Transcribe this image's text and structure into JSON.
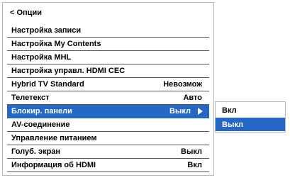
{
  "menu": {
    "title": "< Опции",
    "items": [
      {
        "label": "Настройка записи",
        "value": ""
      },
      {
        "label": "Настройка My Contents",
        "value": ""
      },
      {
        "label": "Настройка MHL",
        "value": ""
      },
      {
        "label": "Настройка управл. HDMI CEC",
        "value": ""
      },
      {
        "label": "Hybrid TV Standard",
        "value": "Невозмож"
      },
      {
        "label": "Телетекст",
        "value": "Авто"
      },
      {
        "label": "Блокир. панели",
        "value": "Выкл"
      },
      {
        "label": "AV-соединение",
        "value": ""
      },
      {
        "label": "Управление питанием",
        "value": ""
      },
      {
        "label": "Голуб. экран",
        "value": "Выкл"
      },
      {
        "label": "Информация об HDMI",
        "value": "Вкл"
      }
    ],
    "selected_index": 6
  },
  "submenu": {
    "options": [
      "Вкл",
      "Выкл"
    ],
    "selected_index": 1
  },
  "colors": {
    "highlight": "#2467c5",
    "border": "#b8b8b8",
    "divider": "#555555"
  }
}
